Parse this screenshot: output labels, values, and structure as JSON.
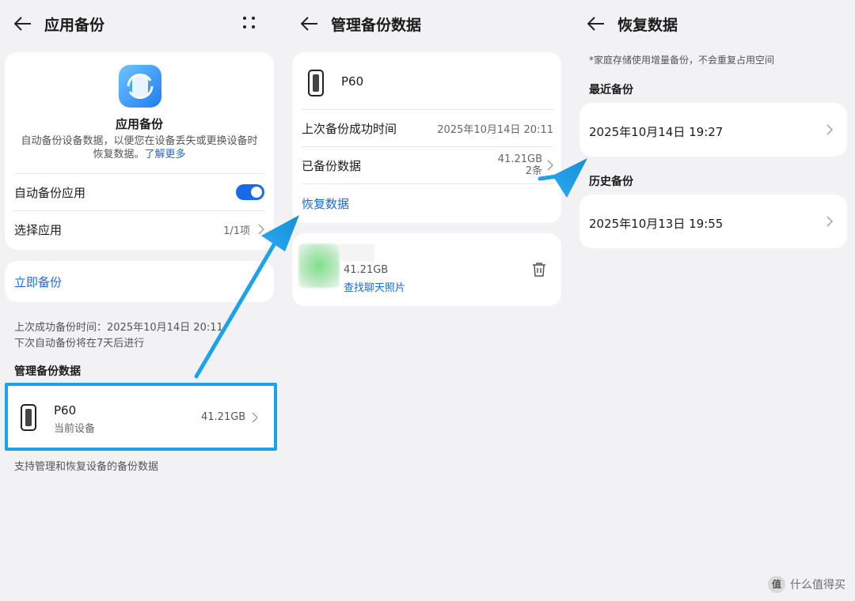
{
  "panel1": {
    "title": "应用备份",
    "app_title": "应用备份",
    "desc_line1": "自动备份设备数据，以便您在设备丢失或更换设备时",
    "desc_line2": "恢复数据。",
    "learn_more": "了解更多",
    "auto_backup_label": "自动备份应用",
    "auto_backup_on": true,
    "select_apps_label": "选择应用",
    "select_apps_value": "1/1项",
    "backup_now": "立即备份",
    "last_backup": "上次成功备份时间：2025年10月14日 20:11",
    "next_backup": "下次自动备份将在7天后进行",
    "section_manage": "管理备份数据",
    "device_name": "P60",
    "device_sub": "当前设备",
    "device_size": "41.21GB",
    "footer_note": "支持管理和恢复设备的备份数据"
  },
  "panel2": {
    "title": "管理备份数据",
    "device_name": "P60",
    "last_time_label": "上次备份成功时间",
    "last_time_value": "2025年10月14日 20:11",
    "backed_label": "已备份数据",
    "backed_size": "41.21GB",
    "backed_count": "2条",
    "restore_link": "恢复数据",
    "app_size": "41.21GB",
    "find_photos": "查找聊天照片"
  },
  "panel3": {
    "title": "恢复数据",
    "note": "*家庭存储使用增量备份，不会重复占用空间",
    "recent_section": "最近备份",
    "recent_item": "2025年10月14日 19:27",
    "history_section": "历史备份",
    "history_item": "2025年10月13日 19:55"
  },
  "watermark": {
    "text": "什么值得买",
    "icon": "值"
  },
  "colors": {
    "accent": "#1a6ae8",
    "highlight": "#1aa3e8",
    "bg": "#f2f2f4"
  }
}
